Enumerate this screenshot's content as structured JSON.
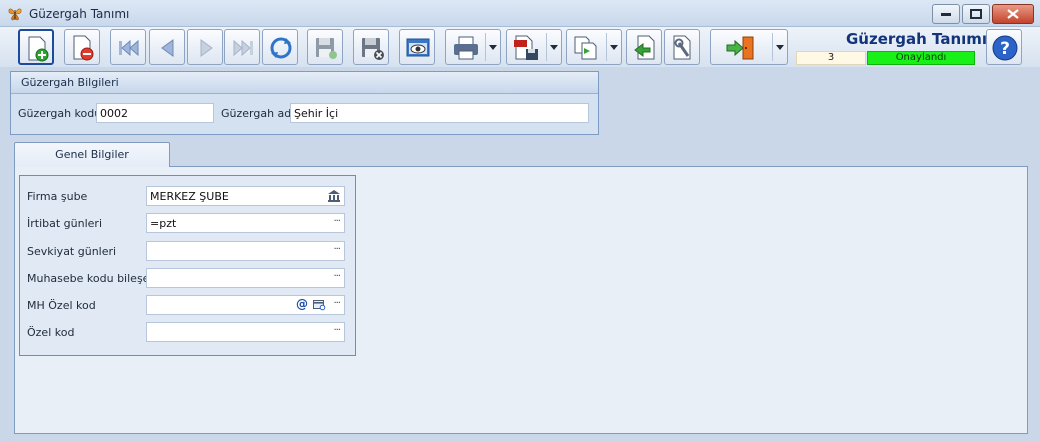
{
  "window": {
    "title": "Güzergah Tanımı"
  },
  "toolbar": {
    "items": [
      "new-record-icon",
      "delete-record-icon",
      "first-record-icon",
      "previous-record-icon",
      "next-record-icon",
      "last-record-icon",
      "refresh-icon",
      "save-icon",
      "discard-icon",
      "preview-icon",
      "print-icon",
      "export-pdf-icon",
      "copy-document-icon",
      "import-icon",
      "settings-icon",
      "exit-icon"
    ]
  },
  "header": {
    "form_title": "Güzergah Tanımı",
    "record_number": "3",
    "status": "Onaylandı",
    "status_color": "#18f018"
  },
  "route_info": {
    "title": "Güzergah Bilgileri",
    "code_label": "Güzergah kodu",
    "code_value": "0002",
    "name_label": "Güzergah adı",
    "name_value": "Şehir İçi"
  },
  "tabs": [
    {
      "label": "Genel Bilgiler",
      "active": true
    }
  ],
  "general": {
    "fields": [
      {
        "label": "Firma şube",
        "value": "MERKEZ ŞUBE"
      },
      {
        "label": "İrtibat günleri",
        "value": "=pzt"
      },
      {
        "label": "Sevkiyat günleri",
        "value": ""
      },
      {
        "label": "Muhasebe kodu bileşeni",
        "value": ""
      },
      {
        "label": "MH Özel kod",
        "value": ""
      },
      {
        "label": "Özel kod",
        "value": ""
      }
    ],
    "ellipsis": "···"
  }
}
